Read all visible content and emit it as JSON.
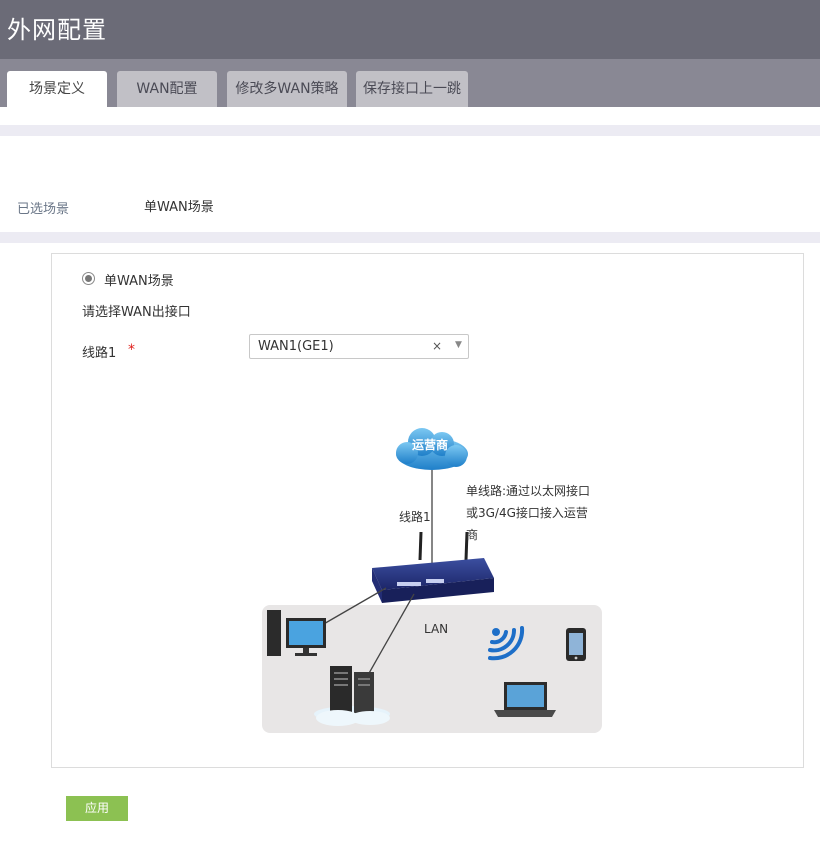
{
  "header": {
    "title": "外网配置"
  },
  "tabs": [
    {
      "label": "场景定义",
      "active": true
    },
    {
      "label": "WAN配置",
      "active": false
    },
    {
      "label": "修改多WAN策略",
      "active": false
    },
    {
      "label": "保存接口上一跳",
      "active": false
    }
  ],
  "selected_scene": {
    "label": "已选场景",
    "value": "单WAN场景"
  },
  "form": {
    "radio_label": "单WAN场景",
    "prompt": "请选择WAN出接口",
    "line_label": "线路1",
    "required_mark": "*",
    "select_value": "WAN1(GE1)",
    "clear_glyph": "×",
    "arrow_glyph": "▼"
  },
  "diagram": {
    "isp_label": "运营商",
    "link_label": "线路1",
    "description": "单线路:通过以太网接口或3G/4G接口接入运营商",
    "lan_label": "LAN"
  },
  "apply_button": {
    "label": "应用"
  },
  "colors": {
    "header": "#6b6b77",
    "tabbar": "#898894",
    "apply": "#8cc152",
    "required": "#e0201c"
  }
}
